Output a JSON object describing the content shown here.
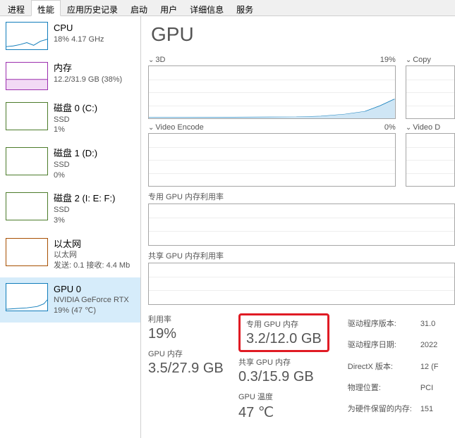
{
  "tabs": {
    "processes": "进程",
    "performance": "性能",
    "app_history": "应用历史记录",
    "startup": "启动",
    "users": "用户",
    "details": "详细信息",
    "services": "服务",
    "active": "性能"
  },
  "sidebar": [
    {
      "key": "cpu",
      "title": "CPU",
      "sub": "18% 4.17 GHz",
      "color": "cpu-c"
    },
    {
      "key": "mem",
      "title": "内存",
      "sub": "12.2/31.9 GB (38%)",
      "color": "mem-c"
    },
    {
      "key": "disk0",
      "title": "磁盘 0 (C:)",
      "sub": "SSD",
      "sub2": "1%",
      "color": "disk-c"
    },
    {
      "key": "disk1",
      "title": "磁盘 1 (D:)",
      "sub": "SSD",
      "sub2": "0%",
      "color": "disk-c"
    },
    {
      "key": "disk2",
      "title": "磁盘 2 (I: E: F:)",
      "sub": "SSD",
      "sub2": "3%",
      "color": "disk-c"
    },
    {
      "key": "eth",
      "title": "以太网",
      "sub": "以太网",
      "sub2": "发送: 0.1 接收: 4.4 Mb",
      "color": "net-c"
    },
    {
      "key": "gpu0",
      "title": "GPU 0",
      "sub": "NVIDIA GeForce RTX",
      "sub2": "19% (47 ℃)",
      "color": "gpu-c",
      "selected": true
    }
  ],
  "page_title": "GPU",
  "charts": {
    "threeD": {
      "label": "3D",
      "pct": "19%"
    },
    "copy": {
      "label": "Copy"
    },
    "video_encode": {
      "label": "Video Encode",
      "pct": "0%"
    },
    "video_d": {
      "label": "Video D"
    },
    "dedicated_mem": {
      "label": "专用 GPU 内存利用率"
    },
    "shared_mem": {
      "label": "共享 GPU 内存利用率"
    }
  },
  "stats": {
    "util": {
      "label": "利用率",
      "value": "19%"
    },
    "dedicated": {
      "label": "专用 GPU 内存",
      "value": "3.2/12.0 GB"
    },
    "gpu_mem": {
      "label": "GPU 内存",
      "value": "3.5/27.9 GB"
    },
    "shared": {
      "label": "共享 GPU 内存",
      "value": "0.3/15.9 GB"
    },
    "temp": {
      "label": "GPU 温度",
      "value": "47 ℃"
    }
  },
  "info": {
    "driver_ver_label": "驱动程序版本:",
    "driver_ver": "31.0",
    "driver_date_label": "驱动程序日期:",
    "driver_date": "2022",
    "directx_label": "DirectX 版本:",
    "directx": "12 (F",
    "location_label": "物理位置:",
    "location": "PCI ",
    "reserved_label": "为硬件保留的内存:",
    "reserved": "151"
  }
}
